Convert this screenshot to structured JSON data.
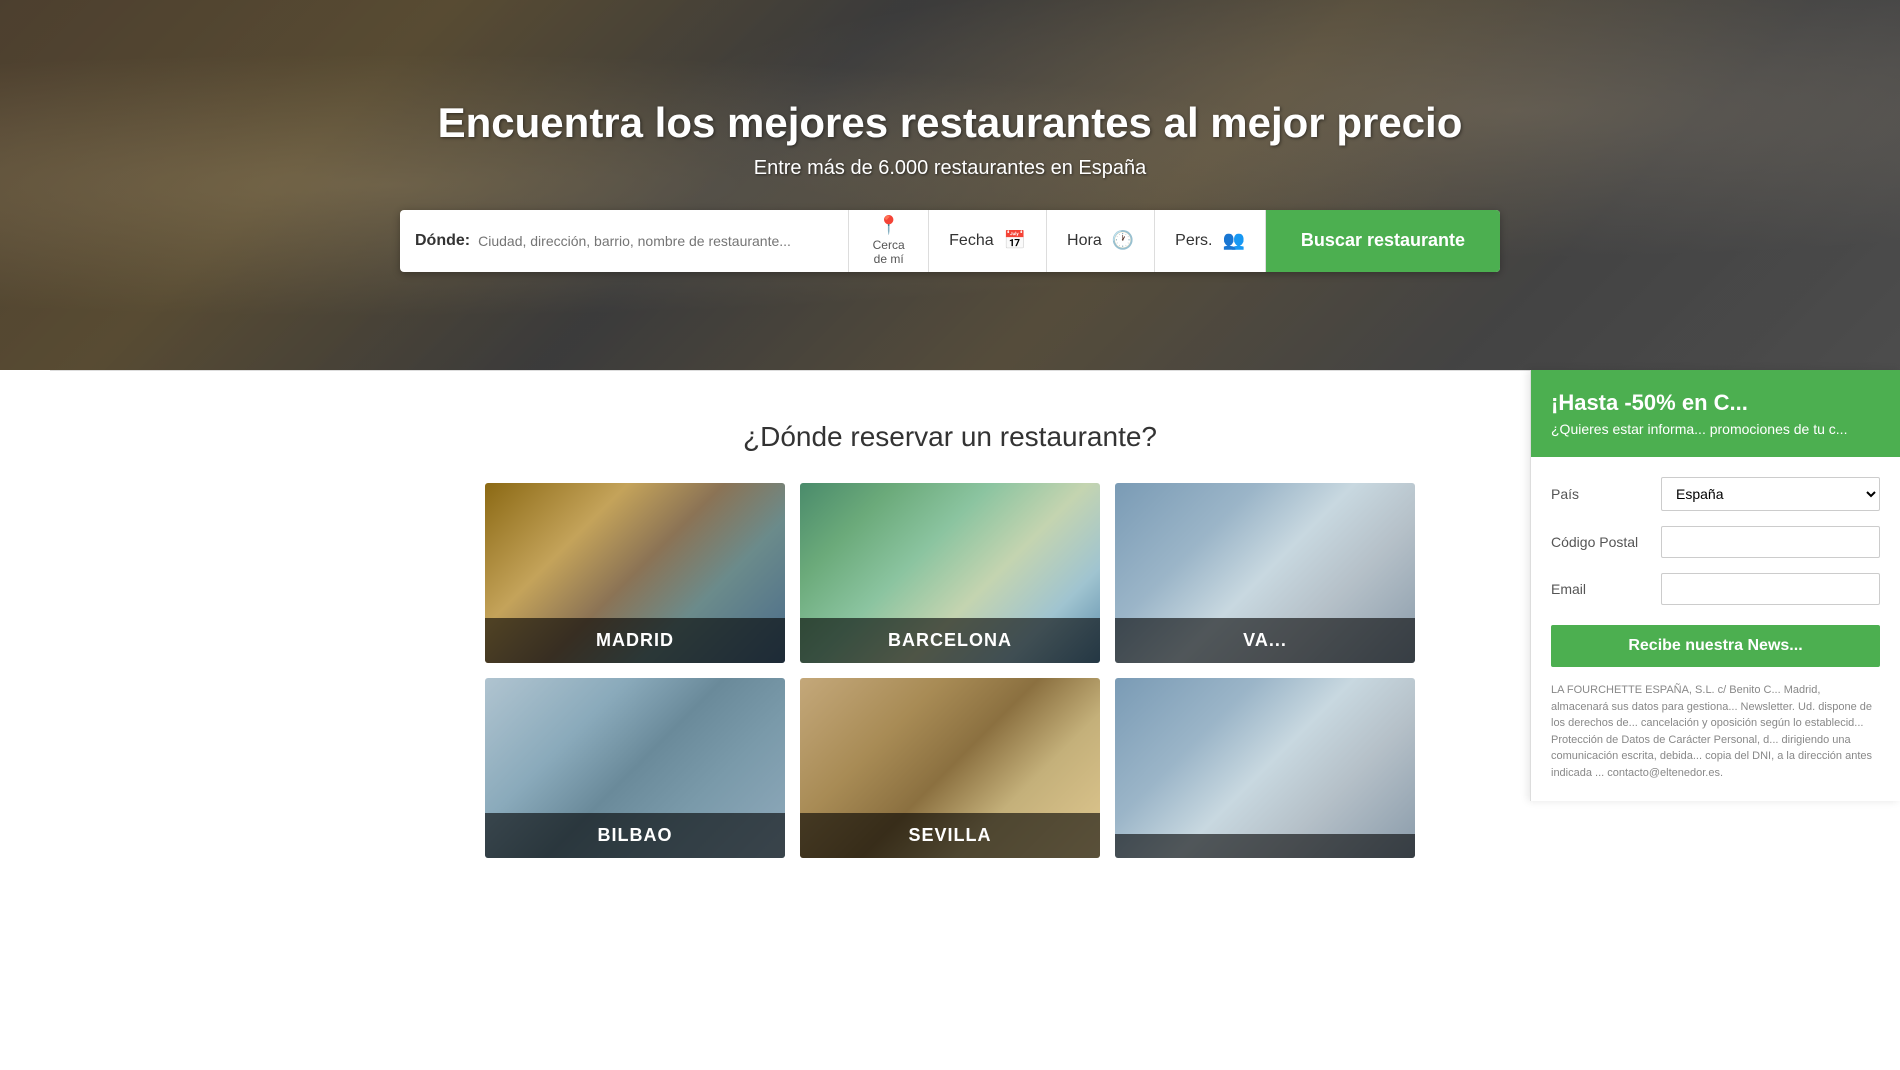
{
  "hero": {
    "title": "Encuentra los mejores restaurantes al mejor precio",
    "subtitle": "Entre más de 6.000 restaurantes en España"
  },
  "search": {
    "donde_label": "Dónde:",
    "donde_placeholder": "Ciudad, dirección, barrio, nombre de restaurante...",
    "near_me_label": "Cerca\nde mí",
    "fecha_label": "Fecha",
    "hora_label": "Hora",
    "pers_label": "Pers.",
    "button_label": "Buscar restaurante"
  },
  "section": {
    "title": "¿Dónde reservar un restaurante?"
  },
  "cities": [
    {
      "name": "MADRID",
      "bg_class": "city-card-madrid-bg"
    },
    {
      "name": "BARCELONA",
      "bg_class": "city-card-barcelona-bg"
    },
    {
      "name": "VA...",
      "bg_class": "city-card-valencia-bg"
    },
    {
      "name": "BILBAO",
      "bg_class": "city-card-bilbao-bg"
    },
    {
      "name": "SEVILLA",
      "bg_class": "city-card-sevilla-bg"
    },
    {
      "name": "",
      "bg_class": "city-card-valencia-bg"
    }
  ],
  "newsletter": {
    "header": "¡Hasta -50% en C...",
    "subtext": "¿Quieres estar informa... promociones de tu c...",
    "pais_label": "País",
    "pais_value": "España",
    "codigo_postal_label": "Código Postal",
    "email_label": "Email",
    "submit_label": "Recibe nuestra News...",
    "legal_text": "LA FOURCHETTE ESPAÑA, S.L. c/ Benito C... Madrid, almacenará sus datos para gestiona... Newsletter. Ud. dispone de los derechos de... cancelación y oposición según lo establecid... Protección de Datos de Carácter Personal, d... dirigiendo una comunicación escrita, debida... copia del DNI, a la dirección antes indicada ... contacto@eltenedor.es."
  }
}
